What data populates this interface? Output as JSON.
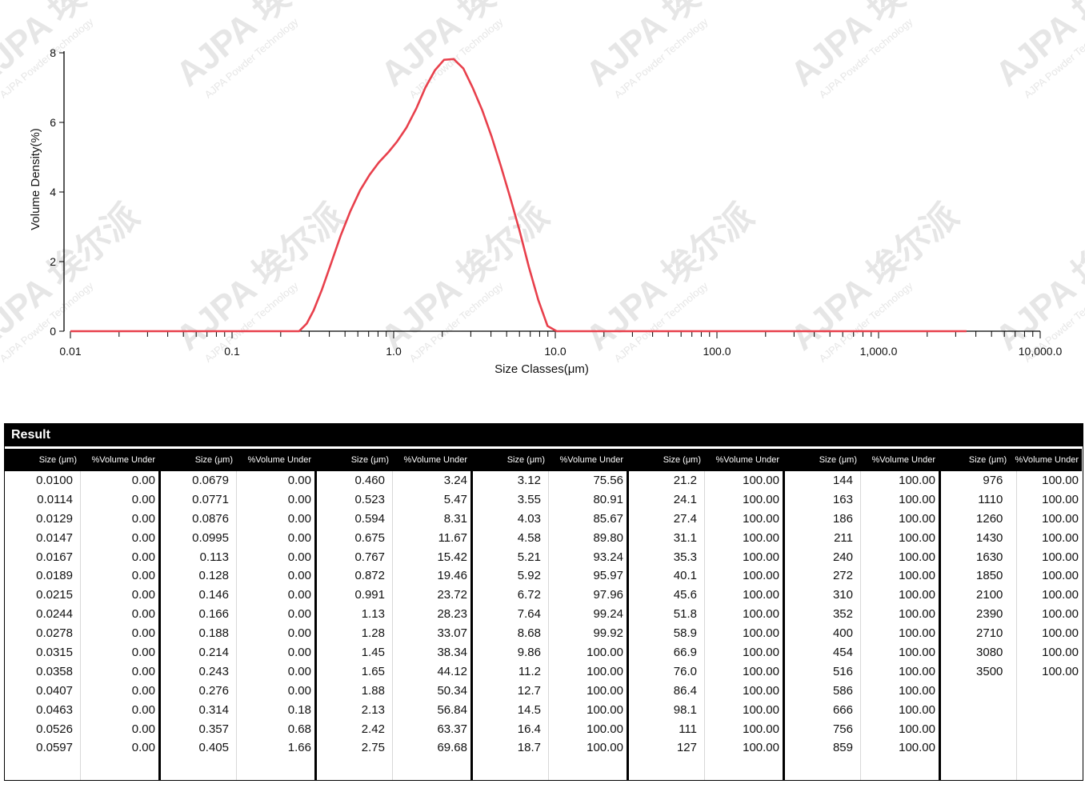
{
  "chart_data": {
    "type": "line",
    "xlabel": "Size Classes(μm)",
    "ylabel": "Volume Density(%)",
    "xscale": "log",
    "xlim": [
      0.01,
      10000
    ],
    "ylim": [
      0,
      8
    ],
    "x_ticks": [
      "0.01",
      "0.1",
      "1.0",
      "10.0",
      "100.0",
      "1,000.0",
      "10,000.0"
    ],
    "y_ticks": [
      "0",
      "2",
      "4",
      "6",
      "8"
    ],
    "grid": false,
    "line_color": "#e8404c",
    "series": [
      {
        "x": [
          0.01,
          0.1,
          0.26,
          0.29,
          0.32,
          0.36,
          0.41,
          0.47,
          0.54,
          0.62,
          0.71,
          0.81,
          0.93,
          1.05,
          1.2,
          1.38,
          1.57,
          1.8,
          2.05,
          2.35,
          2.7,
          3.08,
          3.53,
          4.03,
          4.6,
          5.25,
          6.0,
          6.86,
          7.84,
          8.95,
          10.2,
          11.7,
          100,
          1000,
          3500
        ],
        "y": [
          0,
          0,
          0,
          0.22,
          0.6,
          1.2,
          1.95,
          2.75,
          3.45,
          4.05,
          4.5,
          4.85,
          5.15,
          5.45,
          5.85,
          6.4,
          7.0,
          7.5,
          7.8,
          7.82,
          7.55,
          7.0,
          6.35,
          5.6,
          4.75,
          3.85,
          2.9,
          1.85,
          0.9,
          0.15,
          0.0,
          0,
          0,
          0,
          0
        ]
      }
    ]
  },
  "result": {
    "title": "Result",
    "size_header": "Size (μm)",
    "volume_header": "%Volume Under",
    "groups": [
      [
        [
          "0.0100",
          "0.00"
        ],
        [
          "0.0114",
          "0.00"
        ],
        [
          "0.0129",
          "0.00"
        ],
        [
          "0.0147",
          "0.00"
        ],
        [
          "0.0167",
          "0.00"
        ],
        [
          "0.0189",
          "0.00"
        ],
        [
          "0.0215",
          "0.00"
        ],
        [
          "0.0244",
          "0.00"
        ],
        [
          "0.0278",
          "0.00"
        ],
        [
          "0.0315",
          "0.00"
        ],
        [
          "0.0358",
          "0.00"
        ],
        [
          "0.0407",
          "0.00"
        ],
        [
          "0.0463",
          "0.00"
        ],
        [
          "0.0526",
          "0.00"
        ],
        [
          "0.0597",
          "0.00"
        ]
      ],
      [
        [
          "0.0679",
          "0.00"
        ],
        [
          "0.0771",
          "0.00"
        ],
        [
          "0.0876",
          "0.00"
        ],
        [
          "0.0995",
          "0.00"
        ],
        [
          "0.113",
          "0.00"
        ],
        [
          "0.128",
          "0.00"
        ],
        [
          "0.146",
          "0.00"
        ],
        [
          "0.166",
          "0.00"
        ],
        [
          "0.188",
          "0.00"
        ],
        [
          "0.214",
          "0.00"
        ],
        [
          "0.243",
          "0.00"
        ],
        [
          "0.276",
          "0.00"
        ],
        [
          "0.314",
          "0.18"
        ],
        [
          "0.357",
          "0.68"
        ],
        [
          "0.405",
          "1.66"
        ]
      ],
      [
        [
          "0.460",
          "3.24"
        ],
        [
          "0.523",
          "5.47"
        ],
        [
          "0.594",
          "8.31"
        ],
        [
          "0.675",
          "11.67"
        ],
        [
          "0.767",
          "15.42"
        ],
        [
          "0.872",
          "19.46"
        ],
        [
          "0.991",
          "23.72"
        ],
        [
          "1.13",
          "28.23"
        ],
        [
          "1.28",
          "33.07"
        ],
        [
          "1.45",
          "38.34"
        ],
        [
          "1.65",
          "44.12"
        ],
        [
          "1.88",
          "50.34"
        ],
        [
          "2.13",
          "56.84"
        ],
        [
          "2.42",
          "63.37"
        ],
        [
          "2.75",
          "69.68"
        ]
      ],
      [
        [
          "3.12",
          "75.56"
        ],
        [
          "3.55",
          "80.91"
        ],
        [
          "4.03",
          "85.67"
        ],
        [
          "4.58",
          "89.80"
        ],
        [
          "5.21",
          "93.24"
        ],
        [
          "5.92",
          "95.97"
        ],
        [
          "6.72",
          "97.96"
        ],
        [
          "7.64",
          "99.24"
        ],
        [
          "8.68",
          "99.92"
        ],
        [
          "9.86",
          "100.00"
        ],
        [
          "11.2",
          "100.00"
        ],
        [
          "12.7",
          "100.00"
        ],
        [
          "14.5",
          "100.00"
        ],
        [
          "16.4",
          "100.00"
        ],
        [
          "18.7",
          "100.00"
        ]
      ],
      [
        [
          "21.2",
          "100.00"
        ],
        [
          "24.1",
          "100.00"
        ],
        [
          "27.4",
          "100.00"
        ],
        [
          "31.1",
          "100.00"
        ],
        [
          "35.3",
          "100.00"
        ],
        [
          "40.1",
          "100.00"
        ],
        [
          "45.6",
          "100.00"
        ],
        [
          "51.8",
          "100.00"
        ],
        [
          "58.9",
          "100.00"
        ],
        [
          "66.9",
          "100.00"
        ],
        [
          "76.0",
          "100.00"
        ],
        [
          "86.4",
          "100.00"
        ],
        [
          "98.1",
          "100.00"
        ],
        [
          "111",
          "100.00"
        ],
        [
          "127",
          "100.00"
        ]
      ],
      [
        [
          "144",
          "100.00"
        ],
        [
          "163",
          "100.00"
        ],
        [
          "186",
          "100.00"
        ],
        [
          "211",
          "100.00"
        ],
        [
          "240",
          "100.00"
        ],
        [
          "272",
          "100.00"
        ],
        [
          "310",
          "100.00"
        ],
        [
          "352",
          "100.00"
        ],
        [
          "400",
          "100.00"
        ],
        [
          "454",
          "100.00"
        ],
        [
          "516",
          "100.00"
        ],
        [
          "586",
          "100.00"
        ],
        [
          "666",
          "100.00"
        ],
        [
          "756",
          "100.00"
        ],
        [
          "859",
          "100.00"
        ]
      ],
      [
        [
          "976",
          "100.00"
        ],
        [
          "1110",
          "100.00"
        ],
        [
          "1260",
          "100.00"
        ],
        [
          "1430",
          "100.00"
        ],
        [
          "1630",
          "100.00"
        ],
        [
          "1850",
          "100.00"
        ],
        [
          "2100",
          "100.00"
        ],
        [
          "2390",
          "100.00"
        ],
        [
          "2710",
          "100.00"
        ],
        [
          "3080",
          "100.00"
        ],
        [
          "3500",
          "100.00"
        ]
      ]
    ]
  },
  "watermark": {
    "text": "AJPA 埃尔派",
    "subtext": "AJPA Powder Technology",
    "color": "#e6e6e6"
  }
}
